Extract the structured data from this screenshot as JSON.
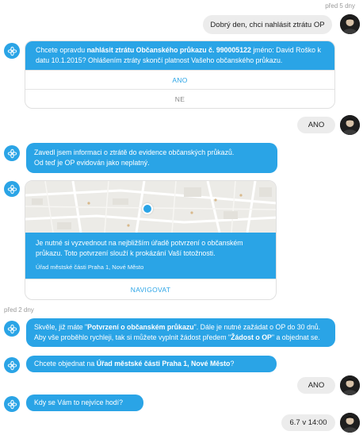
{
  "m1": {
    "time": "před 5 dny",
    "text": "Dobrý den, chci nahlásit ztrátu OP"
  },
  "m2": {
    "pre": "Chcete opravdu ",
    "bold": "nahlásit ztrátu Občanského průkazu č. 990005122",
    "post": " jméno: David Roško k datu 10.1.2015? Ohlášením ztráty skončí platnost Vašeho občanského průkazu.",
    "yes": "ANO",
    "no": "NE"
  },
  "m3": {
    "text": "ANO"
  },
  "m4": {
    "line1": "Zavedl jsem informaci o ztrátě do evidence občanských průkazů.",
    "line2": "Od teď je OP evidován jako neplatný."
  },
  "m5": {
    "text": "Je nutné si vyzvednout na nejbližším úřadě potvrzení o občanském průkazu. Toto potvrzení slouží k prokázání Vaší totožnosti.",
    "office": "Úřad městské části Praha 1, Nové Město",
    "navigate": "NAVIGOVAT"
  },
  "divider": {
    "time": "před 2 dny"
  },
  "m6": {
    "p1": "Skvěle, již máte \"",
    "b1": "Potvrzení o občanském průkazu",
    "p2": "\". Dále je nutné zažádat o OP do 30 dnů. Aby vše proběhlo rychleji, tak si můžete vyplnit žádost předem \"",
    "b2": "Žádost o OP",
    "p3": "\" a objednat se."
  },
  "m7": {
    "pre": "Chcete objednat na ",
    "bold": "Úřad městské části Praha 1, Nové Město",
    "post": "?"
  },
  "m8": {
    "text": "ANO"
  },
  "m9": {
    "text": "Kdy se Vám to nejvíce hodí?"
  },
  "m10": {
    "text": "6.7 v 14:00"
  },
  "colors": {
    "accent": "#2aa4e6",
    "user_bubble": "#ececec",
    "map_marker": "#2aa4e6"
  },
  "icons": {
    "bot": "chatbot-flower-icon",
    "user": "user-avatar",
    "map": "map-pin-icon"
  }
}
